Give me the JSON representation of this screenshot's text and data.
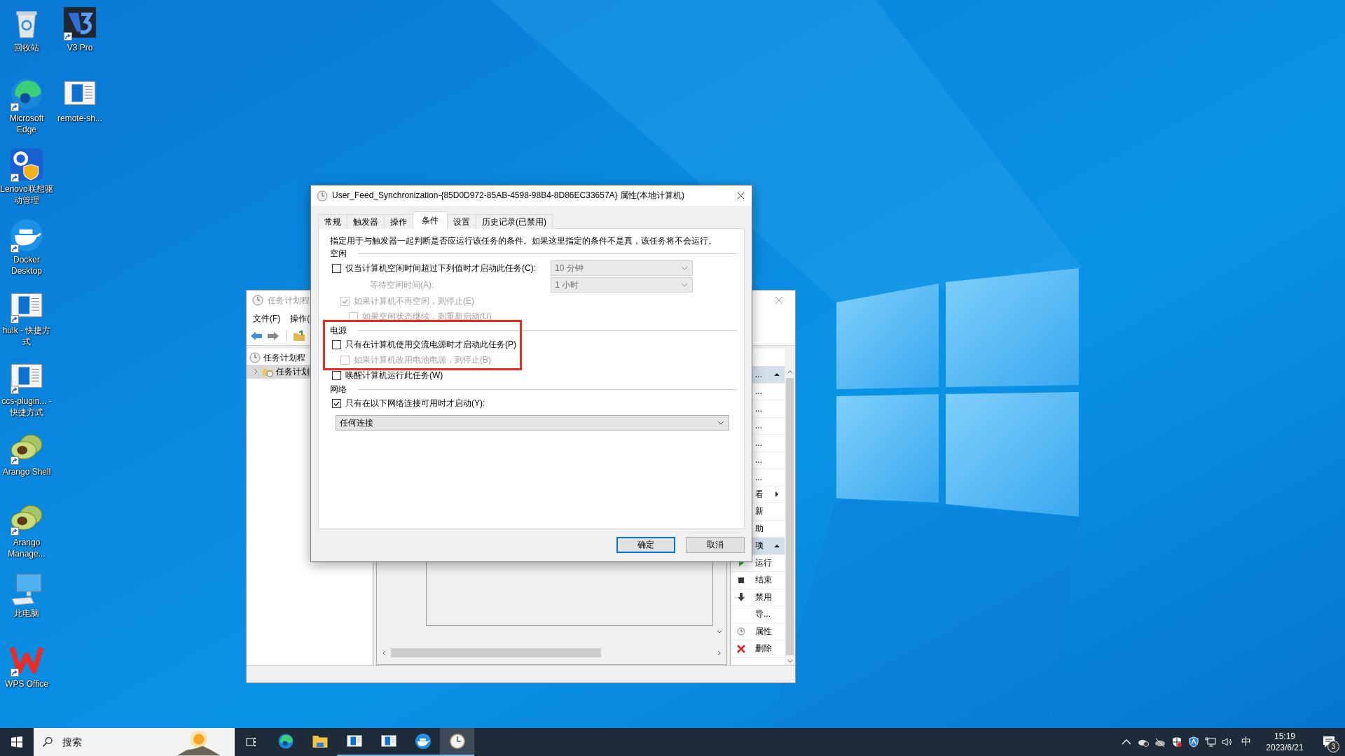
{
  "desktop_icons": [
    {
      "label": "回收站",
      "kind": "recycle-bin",
      "shortcut": false
    },
    {
      "label": "Microsoft Edge",
      "kind": "edge",
      "shortcut": true
    },
    {
      "label": "Lenovo联想驱动管理",
      "kind": "lenovo",
      "shortcut": true
    },
    {
      "label": "Docker Desktop",
      "kind": "docker",
      "shortcut": true
    },
    {
      "label": "hulk - 快捷方式",
      "kind": "app-window",
      "shortcut": true
    },
    {
      "label": "ccs-plugin... - 快捷方式",
      "kind": "app-window",
      "shortcut": true
    },
    {
      "label": "Arango Shell",
      "kind": "avocado",
      "shortcut": true
    },
    {
      "label": "Arango Manage...",
      "kind": "avocado",
      "shortcut": true
    },
    {
      "label": "此电脑",
      "kind": "computer",
      "shortcut": false
    },
    {
      "label": "WPS Office",
      "kind": "wps",
      "shortcut": true
    },
    {
      "label": "V3 Pro",
      "kind": "v3",
      "shortcut": true
    },
    {
      "label": "remote-sh...",
      "kind": "app-window",
      "shortcut": false
    }
  ],
  "background_window": {
    "title": "任务计划程",
    "menu": [
      "文件(F)",
      "操作("
    ],
    "tree": [
      {
        "label": "任务计划程",
        "selected": false,
        "children": [
          {
            "label": "任务计划",
            "selected": true,
            "expanded": false
          }
        ]
      }
    ],
    "actions": [
      {
        "kind": "header",
        "label": "..."
      },
      {
        "kind": "plain",
        "label": "..."
      },
      {
        "kind": "plain",
        "label": "..."
      },
      {
        "kind": "plain",
        "label": "..."
      },
      {
        "kind": "plain",
        "label": "..."
      },
      {
        "kind": "plain",
        "label": "..."
      },
      {
        "kind": "plain",
        "label": "..."
      },
      {
        "kind": "submenu",
        "label": "看"
      },
      {
        "kind": "plain",
        "label": "新"
      },
      {
        "kind": "plain",
        "label": "助"
      },
      {
        "kind": "header",
        "label": "项"
      },
      {
        "kind": "run",
        "label": "运行"
      },
      {
        "kind": "end",
        "label": "结束"
      },
      {
        "kind": "disable",
        "label": "禁用"
      },
      {
        "kind": "plain",
        "label": "导..."
      },
      {
        "kind": "properties",
        "label": "属性"
      },
      {
        "kind": "delete",
        "label": "删除"
      }
    ]
  },
  "dialog": {
    "title": "User_Feed_Synchronization-{85D0D972-85AB-4598-98B4-8D86EC33657A} 属性(本地计算机)",
    "tabs": [
      {
        "label": "常规",
        "selected": false
      },
      {
        "label": "触发器",
        "selected": false
      },
      {
        "label": "操作",
        "selected": false
      },
      {
        "label": "条件",
        "selected": true
      },
      {
        "label": "设置",
        "selected": false
      },
      {
        "label": "历史记录(已禁用)",
        "selected": false
      }
    ],
    "description": "指定用于与触发器一起判断是否应运行该任务的条件。如果这里指定的条件不是真，该任务将不会运行。",
    "sections": [
      {
        "heading": "空闲",
        "rows": [
          {
            "kind": "checkbox",
            "label": "仅当计算机空闲时间超过下列值时才启动此任务(C):",
            "checked": false,
            "disabled": false,
            "dropdown": {
              "value": "10 分钟",
              "disabled": true
            },
            "children": [
              {
                "kind": "field",
                "label": "等待空闲时间(A):",
                "disabled": true,
                "dropdown": {
                  "value": "1 小时",
                  "disabled": true
                }
              },
              {
                "kind": "checkbox",
                "label": "如果计算机不再空闲，则停止(E)",
                "checked": true,
                "disabled": true,
                "children": [
                  {
                    "kind": "checkbox",
                    "label": "如果空闲状态继续，则重新启动(U)",
                    "checked": false,
                    "disabled": true
                  }
                ]
              }
            ]
          }
        ]
      },
      {
        "heading": "电源",
        "highlighted": true,
        "rows": [
          {
            "kind": "checkbox",
            "label": "只有在计算机使用交流电源时才启动此任务(P)",
            "checked": false,
            "disabled": false,
            "children": [
              {
                "kind": "checkbox",
                "label": "如果计算机改用电池电源，则停止(B)",
                "checked": false,
                "disabled": true
              }
            ]
          }
        ]
      },
      {
        "rows": [
          {
            "kind": "checkbox",
            "label": "唤醒计算机运行此任务(W)",
            "checked": false,
            "disabled": false
          }
        ]
      },
      {
        "heading": "网络",
        "rows": [
          {
            "kind": "checkbox",
            "label": "只有在以下网络连接可用时才启动(Y):",
            "checked": true,
            "disabled": false
          },
          {
            "kind": "dropdown",
            "value": "任何连接",
            "disabled": false
          }
        ]
      }
    ],
    "buttons": [
      {
        "label": "确定",
        "default": true
      },
      {
        "label": "取消",
        "default": false
      }
    ]
  },
  "taskbar": {
    "search": {
      "placeholder": "搜索"
    },
    "apps": [
      {
        "kind": "edge",
        "running": false,
        "active": false
      },
      {
        "kind": "explorer",
        "running": false,
        "active": false
      },
      {
        "kind": "app-window",
        "running": true,
        "active": false
      },
      {
        "kind": "app-window",
        "running": true,
        "active": false
      },
      {
        "kind": "docker",
        "running": true,
        "active": false
      },
      {
        "kind": "clock",
        "running": true,
        "active": true
      }
    ],
    "ime": "中",
    "time": "15:19",
    "date": "2023/6/21",
    "notifications": "3"
  }
}
